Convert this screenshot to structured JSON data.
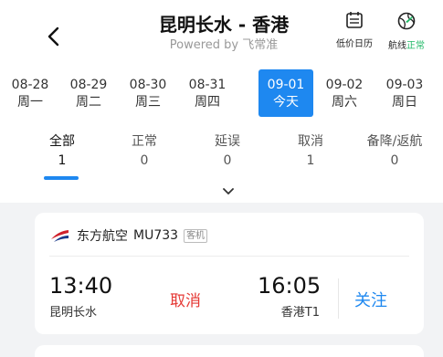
{
  "header": {
    "title": "昆明长水 - 香港",
    "subtitle": "Powered by 飞常准",
    "low_price_calendar_label": "低价日历",
    "route_label_prefix": "航线",
    "route_status": "正常"
  },
  "dates": [
    {
      "date": "08-28",
      "weekday": "周一"
    },
    {
      "date": "08-29",
      "weekday": "周二"
    },
    {
      "date": "08-30",
      "weekday": "周三"
    },
    {
      "date": "08-31",
      "weekday": "周四"
    },
    {
      "date": "09-01",
      "weekday": "今天",
      "selected": true
    },
    {
      "date": "09-02",
      "weekday": "周六"
    },
    {
      "date": "09-03",
      "weekday": "周日"
    }
  ],
  "status_tabs": [
    {
      "label": "全部",
      "count": "1",
      "selected": true
    },
    {
      "label": "正常",
      "count": "0"
    },
    {
      "label": "延误",
      "count": "0"
    },
    {
      "label": "取消",
      "count": "1"
    },
    {
      "label": "备降/返航",
      "count": "0"
    }
  ],
  "flights": [
    {
      "airline": "东方航空",
      "flight_no": "MU733",
      "type_tag": "客机",
      "dep_time": "13:40",
      "dep_airport": "昆明长水",
      "status": "取消",
      "arr_time": "16:05",
      "arr_airport": "香港T1",
      "follow_label": "关注"
    }
  ],
  "colors": {
    "accent": "#1e88f0",
    "cancel": "#e53935",
    "normal": "#1fb866",
    "list_background": "#f2f3f5"
  }
}
